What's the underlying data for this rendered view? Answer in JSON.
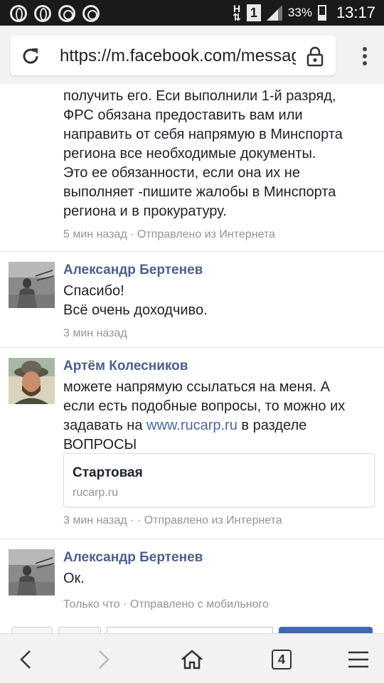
{
  "status_bar": {
    "left_icons": [
      "opera-icon",
      "opera-icon",
      "chrome-icon",
      "chrome-icon"
    ],
    "network": "H",
    "sim": "1",
    "battery": "33%",
    "time": "13:17"
  },
  "browser": {
    "url": "https://m.facebook.com/messages",
    "tab_count": "4"
  },
  "thread": {
    "first_partial": {
      "lines": [
        "получить его. Еси выполнили 1-й разряд,",
        "ФРС обязана предоставить вам или",
        "направить от себя напрямую в Минспорта",
        "региона все необходимые документы.",
        "Это ее обязанности, если она их не",
        "выполняет -пишите жалобы в Минспорта",
        "региона и в прокуратуру."
      ],
      "meta": "5 мин назад · Отправлено из Интернета"
    },
    "comments": [
      {
        "author": "Александр Бертенев",
        "lines": [
          "Спасибо!",
          "Всё очень доходчиво."
        ],
        "meta": "3 мин назад"
      },
      {
        "author": "Артём Колесников",
        "line1": "можете напрямую ссылаться на меня. А",
        "line2": "если есть подобные вопросы, то можно их",
        "line3_before": "задавать на ",
        "line3_link": "www.rucarp.ru",
        "line3_after": " в разделе",
        "line4": "ВОПРОСЫ",
        "preview_title": "Стартовая",
        "preview_domain": "rucarp.ru",
        "meta": "3 мин назад · · Отправлено из Интернета"
      },
      {
        "author": "Александр Бертенев",
        "lines": [
          "Ок."
        ],
        "meta": "Только что · Отправлено с мобильного"
      }
    ]
  },
  "colors": {
    "name": "#4b5f8c",
    "link": "#4b67a1",
    "meta": "#90949c",
    "text": "#1d2129"
  }
}
